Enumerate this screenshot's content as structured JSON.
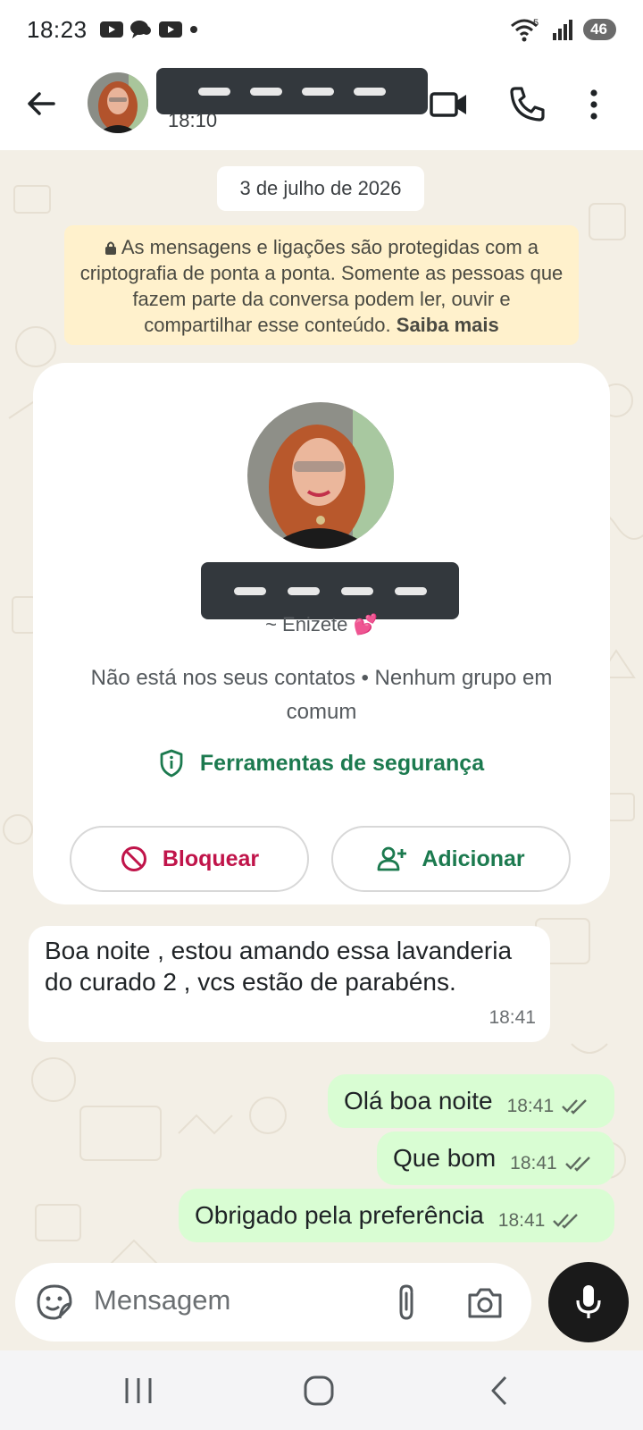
{
  "status_bar": {
    "time": "18:23",
    "battery": "46",
    "wifi_label": "5"
  },
  "header": {
    "last_seen": "18:10"
  },
  "chat": {
    "date_chip": "3 de julho de 2026",
    "encryption_notice": "As mensagens e ligações são protegidas com a criptografia de ponta a ponta. Somente as pessoas que fazem parte da conversa podem ler, ouvir e compartilhar esse conteúdo.",
    "encryption_link": "Saiba mais"
  },
  "contact_card": {
    "push_name": "~ Enizete 💕",
    "info": "Não está nos seus contatos • Nenhum grupo em comum",
    "safety_tools": "Ferramentas de segurança",
    "block_label": "Bloquear",
    "add_label": "Adicionar"
  },
  "messages": [
    {
      "direction": "in",
      "text": "Boa noite , estou amando essa lavanderia do curado 2 , vcs estão de parabéns.",
      "time": "18:41"
    },
    {
      "direction": "out",
      "text": "Olá boa noite",
      "time": "18:41",
      "status": "read"
    },
    {
      "direction": "out",
      "text": "Que bom",
      "time": "18:41",
      "status": "read"
    },
    {
      "direction": "out",
      "text": "Obrigado pela preferência",
      "time": "18:41",
      "status": "read"
    }
  ],
  "composer": {
    "placeholder": "Mensagem"
  },
  "colors": {
    "accent_green": "#1c7a4f",
    "block_red": "#c0144a",
    "outgoing_bubble": "#d9fdd3",
    "notice_bg": "#fff1cc"
  },
  "icons": {
    "header": [
      "back-arrow-icon",
      "video-call-icon",
      "phone-icon",
      "more-vert-icon"
    ],
    "composer": [
      "sticker-icon",
      "attach-icon",
      "camera-icon",
      "mic-icon"
    ],
    "nav": [
      "recents-icon",
      "home-icon",
      "back-icon"
    ]
  }
}
